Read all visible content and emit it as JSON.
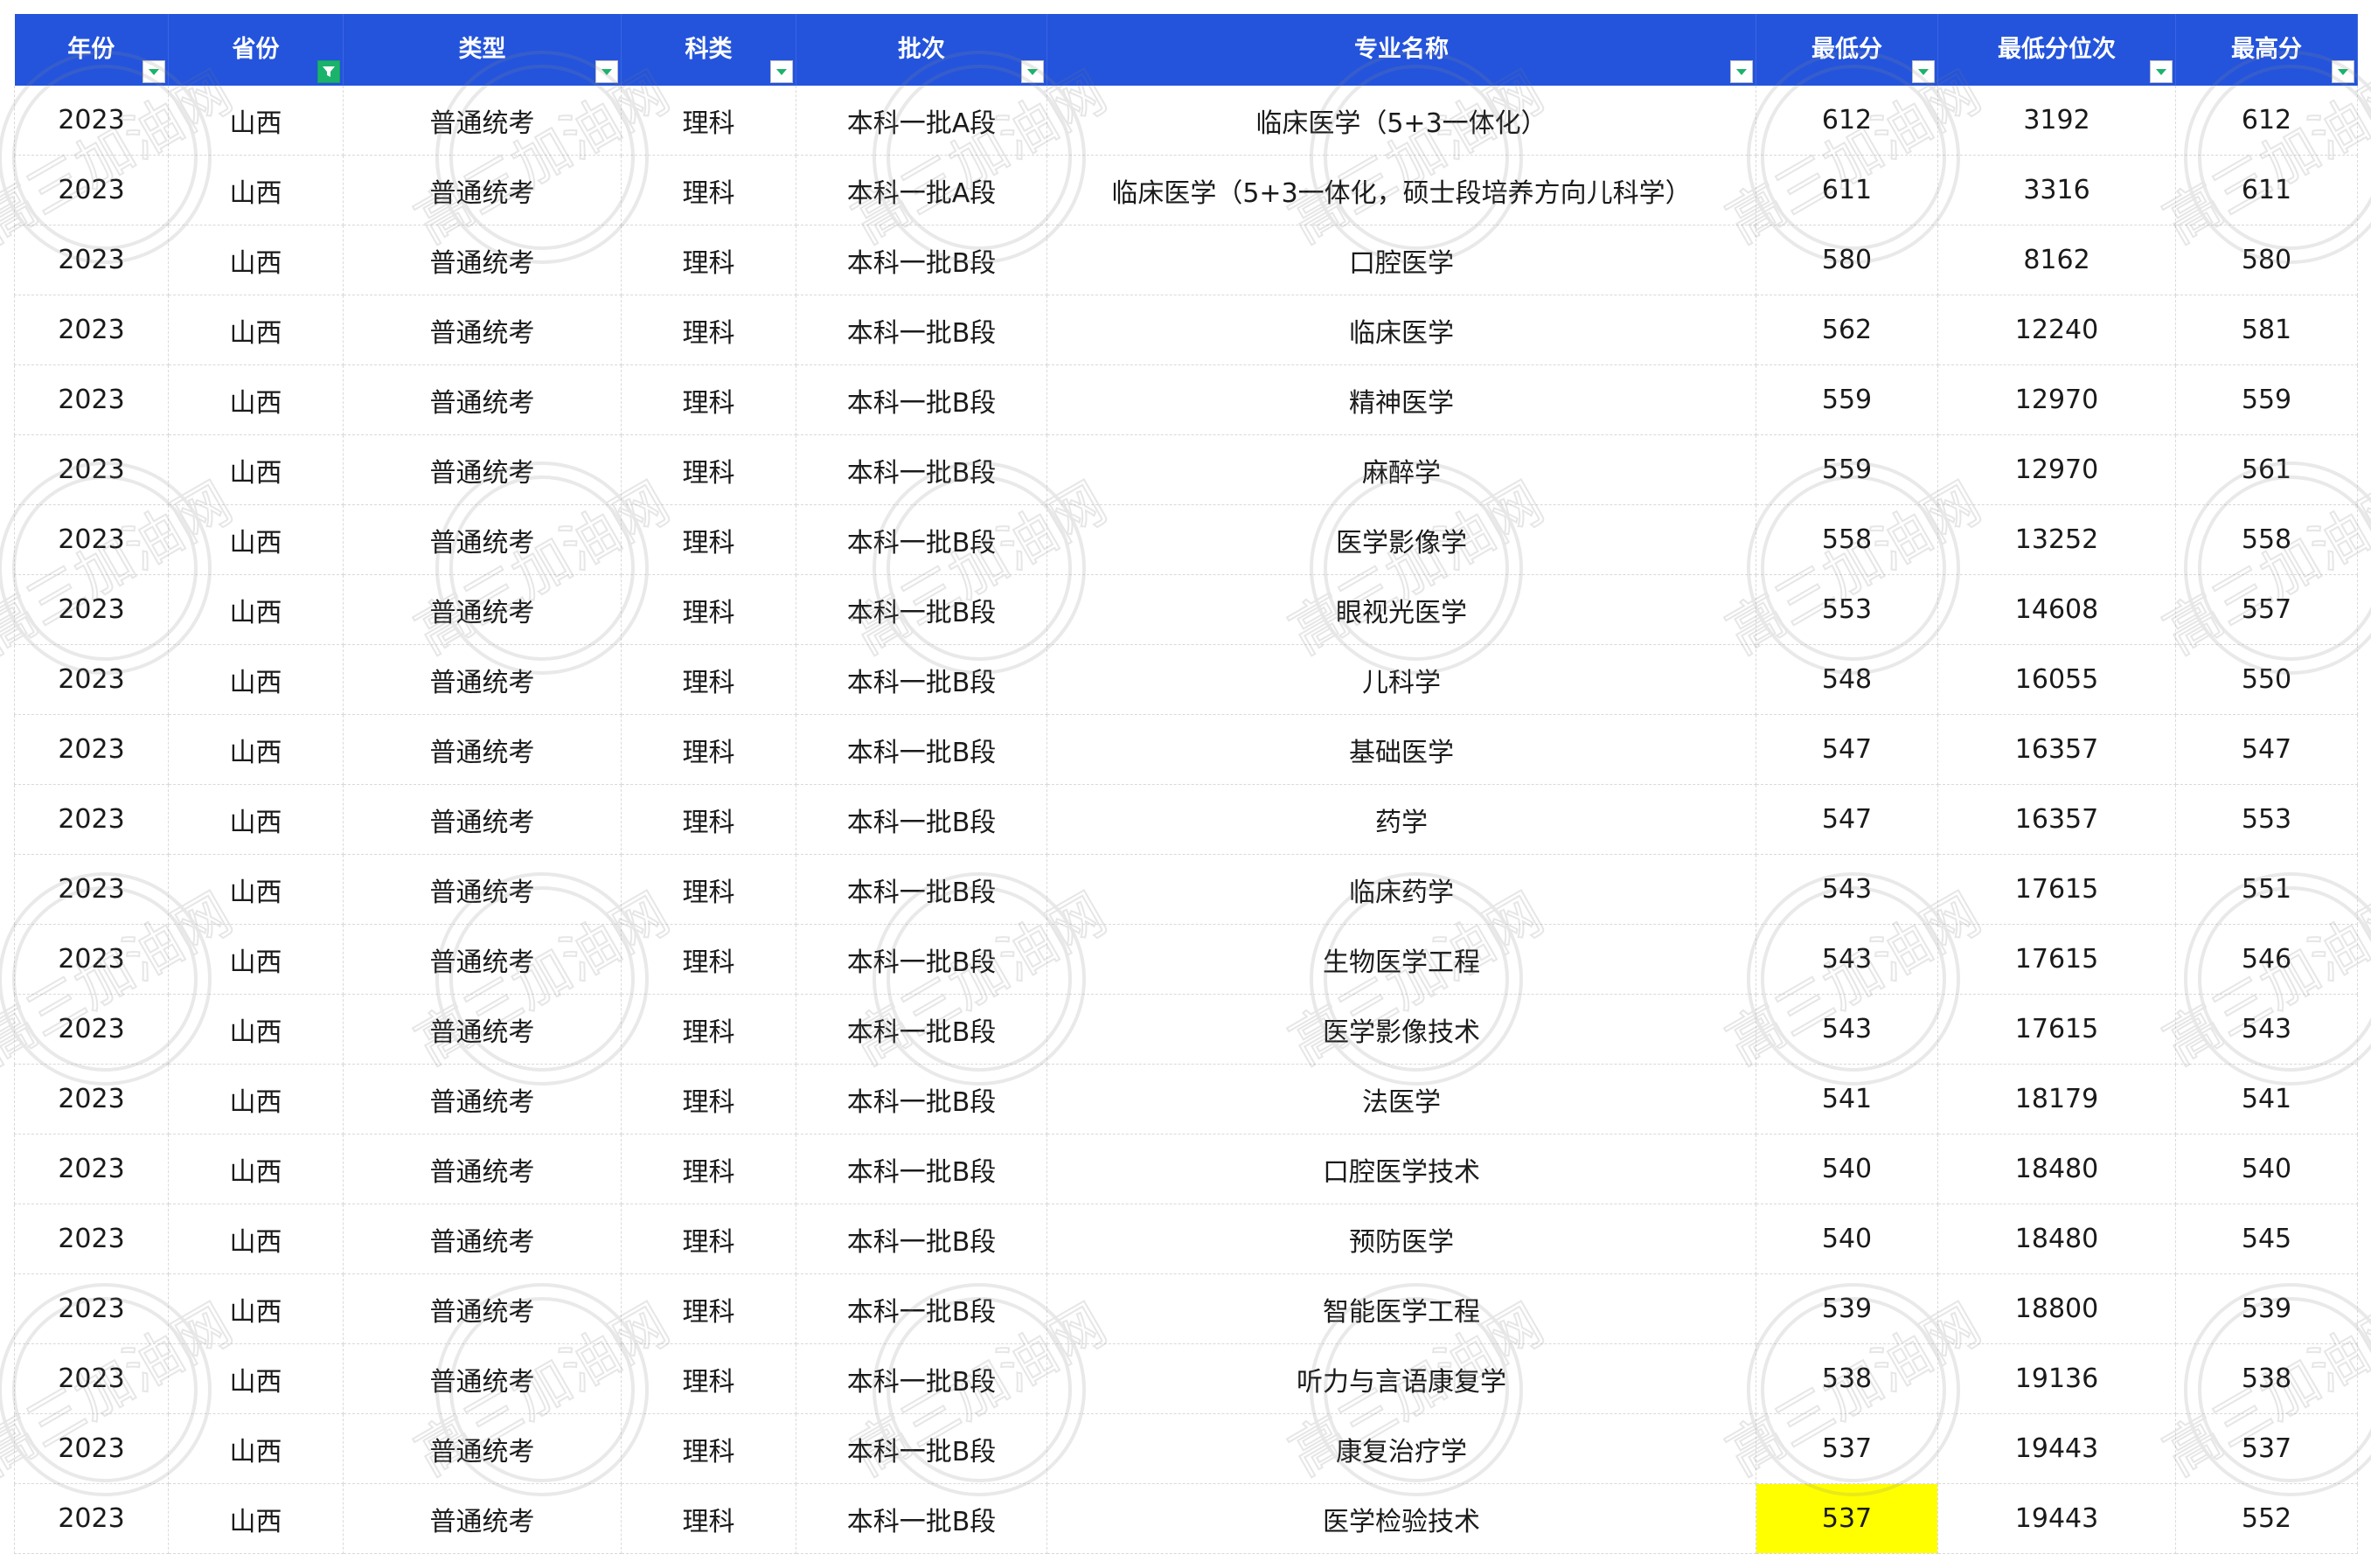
{
  "columns": [
    {
      "label": "年份",
      "filter": "normal"
    },
    {
      "label": "省份",
      "filter": "active"
    },
    {
      "label": "类型",
      "filter": "normal"
    },
    {
      "label": "科类",
      "filter": "normal"
    },
    {
      "label": "批次",
      "filter": "normal"
    },
    {
      "label": "专业名称",
      "filter": "normal"
    },
    {
      "label": "最低分",
      "filter": "normal"
    },
    {
      "label": "最低分位次",
      "filter": "normal"
    },
    {
      "label": "最高分",
      "filter": "normal"
    }
  ],
  "rows": [
    [
      "2023",
      "山西",
      "普通统考",
      "理科",
      "本科一批A段",
      "临床医学（5+3一体化）",
      "612",
      "3192",
      "612"
    ],
    [
      "2023",
      "山西",
      "普通统考",
      "理科",
      "本科一批A段",
      "临床医学（5+3一体化，硕士段培养方向儿科学）",
      "611",
      "3316",
      "611"
    ],
    [
      "2023",
      "山西",
      "普通统考",
      "理科",
      "本科一批B段",
      "口腔医学",
      "580",
      "8162",
      "580"
    ],
    [
      "2023",
      "山西",
      "普通统考",
      "理科",
      "本科一批B段",
      "临床医学",
      "562",
      "12240",
      "581"
    ],
    [
      "2023",
      "山西",
      "普通统考",
      "理科",
      "本科一批B段",
      "精神医学",
      "559",
      "12970",
      "559"
    ],
    [
      "2023",
      "山西",
      "普通统考",
      "理科",
      "本科一批B段",
      "麻醉学",
      "559",
      "12970",
      "561"
    ],
    [
      "2023",
      "山西",
      "普通统考",
      "理科",
      "本科一批B段",
      "医学影像学",
      "558",
      "13252",
      "558"
    ],
    [
      "2023",
      "山西",
      "普通统考",
      "理科",
      "本科一批B段",
      "眼视光医学",
      "553",
      "14608",
      "557"
    ],
    [
      "2023",
      "山西",
      "普通统考",
      "理科",
      "本科一批B段",
      "儿科学",
      "548",
      "16055",
      "550"
    ],
    [
      "2023",
      "山西",
      "普通统考",
      "理科",
      "本科一批B段",
      "基础医学",
      "547",
      "16357",
      "547"
    ],
    [
      "2023",
      "山西",
      "普通统考",
      "理科",
      "本科一批B段",
      "药学",
      "547",
      "16357",
      "553"
    ],
    [
      "2023",
      "山西",
      "普通统考",
      "理科",
      "本科一批B段",
      "临床药学",
      "543",
      "17615",
      "551"
    ],
    [
      "2023",
      "山西",
      "普通统考",
      "理科",
      "本科一批B段",
      "生物医学工程",
      "543",
      "17615",
      "546"
    ],
    [
      "2023",
      "山西",
      "普通统考",
      "理科",
      "本科一批B段",
      "医学影像技术",
      "543",
      "17615",
      "543"
    ],
    [
      "2023",
      "山西",
      "普通统考",
      "理科",
      "本科一批B段",
      "法医学",
      "541",
      "18179",
      "541"
    ],
    [
      "2023",
      "山西",
      "普通统考",
      "理科",
      "本科一批B段",
      "口腔医学技术",
      "540",
      "18480",
      "540"
    ],
    [
      "2023",
      "山西",
      "普通统考",
      "理科",
      "本科一批B段",
      "预防医学",
      "540",
      "18480",
      "545"
    ],
    [
      "2023",
      "山西",
      "普通统考",
      "理科",
      "本科一批B段",
      "智能医学工程",
      "539",
      "18800",
      "539"
    ],
    [
      "2023",
      "山西",
      "普通统考",
      "理科",
      "本科一批B段",
      "听力与言语康复学",
      "538",
      "19136",
      "538"
    ],
    [
      "2023",
      "山西",
      "普通统考",
      "理科",
      "本科一批B段",
      "康复治疗学",
      "537",
      "19443",
      "537"
    ],
    [
      "2023",
      "山西",
      "普通统考",
      "理科",
      "本科一批B段",
      "医学检验技术",
      "537",
      "19443",
      "552"
    ]
  ],
  "highlight": {
    "row": 20,
    "col": 6,
    "color": "#ffff00"
  },
  "colors": {
    "header_bg": "#2454dc",
    "header_text": "#ffffff",
    "filter_active": "#1bb36b"
  },
  "watermark": {
    "text": "高三加油网"
  }
}
